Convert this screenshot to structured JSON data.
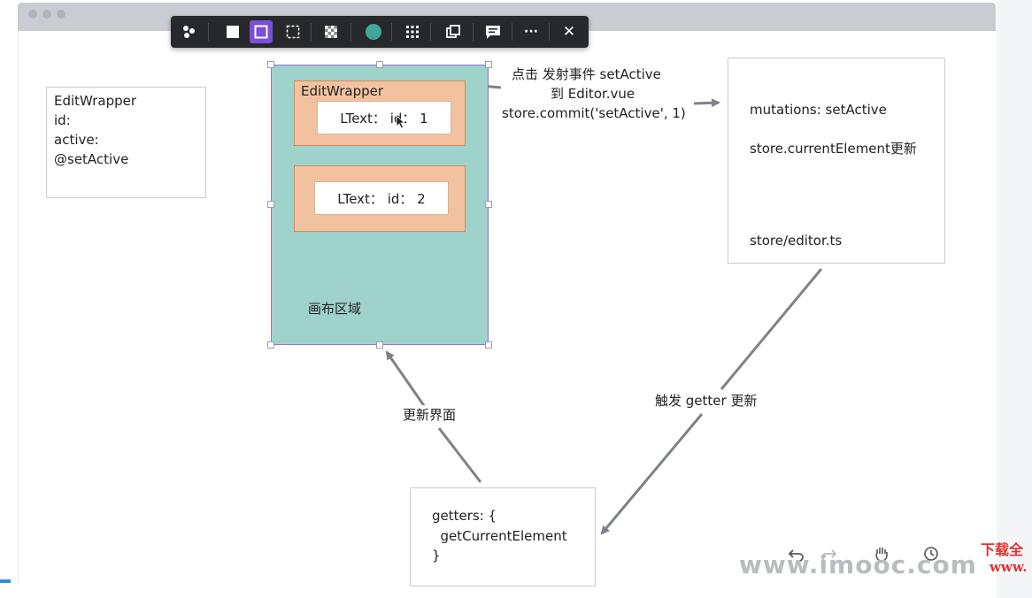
{
  "toolbar": {
    "icons": [
      "bubbles-icon",
      "square-fill-icon",
      "square-outline-icon",
      "dashed-square-icon",
      "checker-icon",
      "color-circle-icon",
      "grid-icon",
      "duplicate-icon",
      "comment-icon",
      "more-icon",
      "close-icon"
    ],
    "more_label": "···",
    "close_label": "✕",
    "accent": "#7b4fd6",
    "circle_color": "#3fa69a"
  },
  "left_box": {
    "lines": [
      "EditWrapper",
      "id:",
      "active:",
      "@setActive"
    ]
  },
  "canvas": {
    "wrapper_label": "EditWrapper",
    "items": [
      {
        "label": "LText：  id：  1"
      },
      {
        "label": "LText：  id：  2"
      }
    ],
    "area_label": "画布区域"
  },
  "annotation_top": {
    "lines": [
      "点击 发射事件 setActive",
      "到 Editor.vue",
      "store.commit('setActive', 1)"
    ]
  },
  "mutations_box": {
    "line1": "mutations: setActive",
    "line2": "store.currentElement更新",
    "line3": "store/editor.ts"
  },
  "getters_box": {
    "lines": [
      "getters: {",
      "  getCurrentElement",
      "}"
    ]
  },
  "labels": {
    "update_ui": "更新界面",
    "trigger_getter": "触发 getter 更新"
  },
  "overlay": {
    "watermark": "www.imooc.com",
    "download_text": "下载全",
    "download_url": "www."
  }
}
